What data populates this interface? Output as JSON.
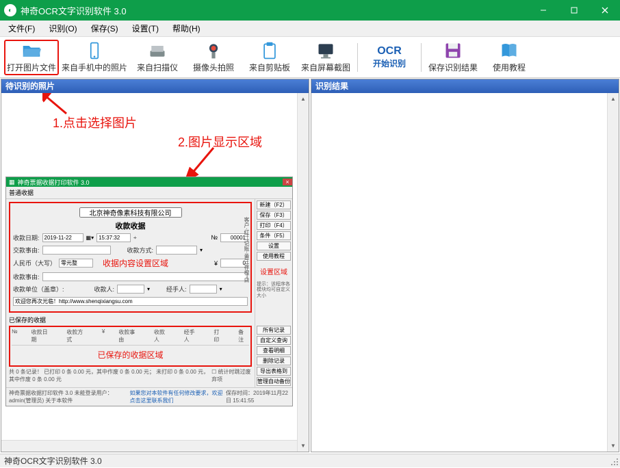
{
  "window": {
    "title": "神奇OCR文字识别软件 3.0"
  },
  "menu": {
    "file": "文件(F)",
    "recognize": "识别(O)",
    "save": "保存(S)",
    "settings": "设置(T)",
    "help": "帮助(H)"
  },
  "toolbar": {
    "open_image": "打开图片文件",
    "from_phone": "来自手机中的照片",
    "from_scanner": "来自扫描仪",
    "from_camera": "摄像头拍照",
    "from_clipboard": "来自剪贴板",
    "from_screenshot": "来自屏幕截图",
    "ocr_text": "OCR",
    "start_recognize": "开始识别",
    "save_result": "保存识别结果",
    "tutorial": "使用教程"
  },
  "panels": {
    "left_title": "待识别的照片",
    "right_title": "识别结果"
  },
  "annotations": {
    "step1": "1.点击选择图片",
    "step2": "2.图片显示区域"
  },
  "inner": {
    "title": "神奇票据收据打印软件 3.0",
    "tab": "普通收据",
    "company": "北京神奇像素科技有限公司",
    "receipt_title": "收款收据",
    "date_label": "收款日期:",
    "date_value": "2019-11-22",
    "time_value": "15:37:32",
    "no_label": "№",
    "no_value": "00001",
    "matter_label": "交款事由:",
    "pay_method_label": "收款方式:",
    "rmb_label": "人民币（大写）",
    "rmb_value": "零元整",
    "amount_symbol": "¥",
    "amount_value": "0",
    "reason_label": "收款事由:",
    "unit_label": "收款单位（盖章）:",
    "collector_label": "收款人:",
    "handler_label": "经手人:",
    "welcome": "欢迎您再次光临！http://www.shenqixiangsu.com",
    "content_area": "收据内容设置区域",
    "settings_area": "设置区域",
    "saved_title": "已保存的收据",
    "saved_area": "已保存的收据区域",
    "side_btns": [
      "新建（F2）",
      "保存（F3）",
      "打印（F4）",
      "条件（F5）",
      "设置",
      "使用教程"
    ],
    "side_note": "提示：该程序各模块均可自定义大小",
    "vert_text": "客户·红二记账·黄三存根·白",
    "saved_cols": [
      "№",
      "收款日期",
      "收款方式",
      "¥",
      "收款事由",
      "收款人",
      "经手人",
      "打印",
      "备注"
    ],
    "saved_right": [
      "所有记录",
      "自定义查询",
      "查看明细",
      "删除记录",
      "导出表格到Excel",
      "管理自动备份"
    ],
    "summary": "共 0 条记录！  已打印 0 条 0.00 元，其中作废 0 条 0.00 元；  未打印 0 条 0.00 元，其中作废 0 条 0.00 元",
    "checkbox": "统计时跳过废弃项",
    "footer_left": "神奇票据收据打印软件 3.0   未能登录用户：admin(管理员)   关于本软件",
    "footer_blue": "如果您对本软件有任何修改要求，欢迎点击这里联系我们",
    "footer_right": "保存时间：2019年11月22日 15:41:55"
  },
  "statusbar": {
    "text": "神奇OCR文字识别软件 3.0"
  }
}
